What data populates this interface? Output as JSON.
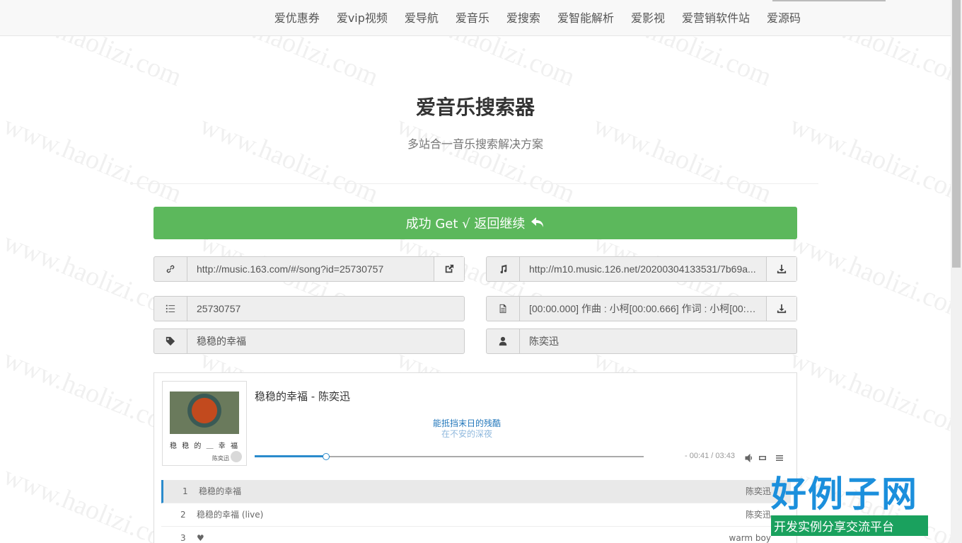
{
  "nav": {
    "items": [
      "爱优惠券",
      "爱vip视频",
      "爱导航",
      "爱音乐",
      "爱搜索",
      "爱智能解析",
      "爱影视",
      "爱营销软件站",
      "爱源码"
    ]
  },
  "header": {
    "title": "爱音乐搜索器",
    "subtitle": "多站合一音乐搜索解决方案"
  },
  "success_button": {
    "label": "成功 Get √ 返回继续"
  },
  "fields": {
    "link": "http://music.163.com/#/song?id=25730757",
    "mp3_url": "http://m10.music.126.net/20200304133531/7b69a...",
    "song_id": "25730757",
    "lrc": "[00:00.000] 作曲 : 小柯[00:00.666] 作词 : 小柯[00:0...",
    "song_name": "稳稳的幸福",
    "artist": "陈奕迅"
  },
  "player": {
    "cover_caption": "稳 稳 的 ＿ 幸 福",
    "cover_sub": "陈奕迅",
    "title": "稳稳的幸福",
    "separator": " - ",
    "artist": "陈奕迅",
    "lyric_current": "能抵挡末日的残酷",
    "lyric_next": "在不安的深夜",
    "time": "- 00:41 / 03:43",
    "progress_fraction": 0.1838,
    "loaded_fraction": 1.0
  },
  "playlist": [
    {
      "num": "1",
      "name": "稳稳的幸福",
      "artist": "陈奕迅"
    },
    {
      "num": "2",
      "name": "稳稳的幸福 (live)",
      "artist": "陈奕迅"
    },
    {
      "num": "3",
      "name": "♥",
      "artist": "warm boy"
    }
  ],
  "watermark": {
    "text": "www.haolizi.com"
  },
  "brand": {
    "title": "好例子网",
    "tagline": "开发实例分享交流平台"
  },
  "colors": {
    "success": "#5cb85c",
    "accent": "#2a8bcc",
    "brand_blue": "#1b8fdc",
    "brand_green": "#1aa15e"
  }
}
